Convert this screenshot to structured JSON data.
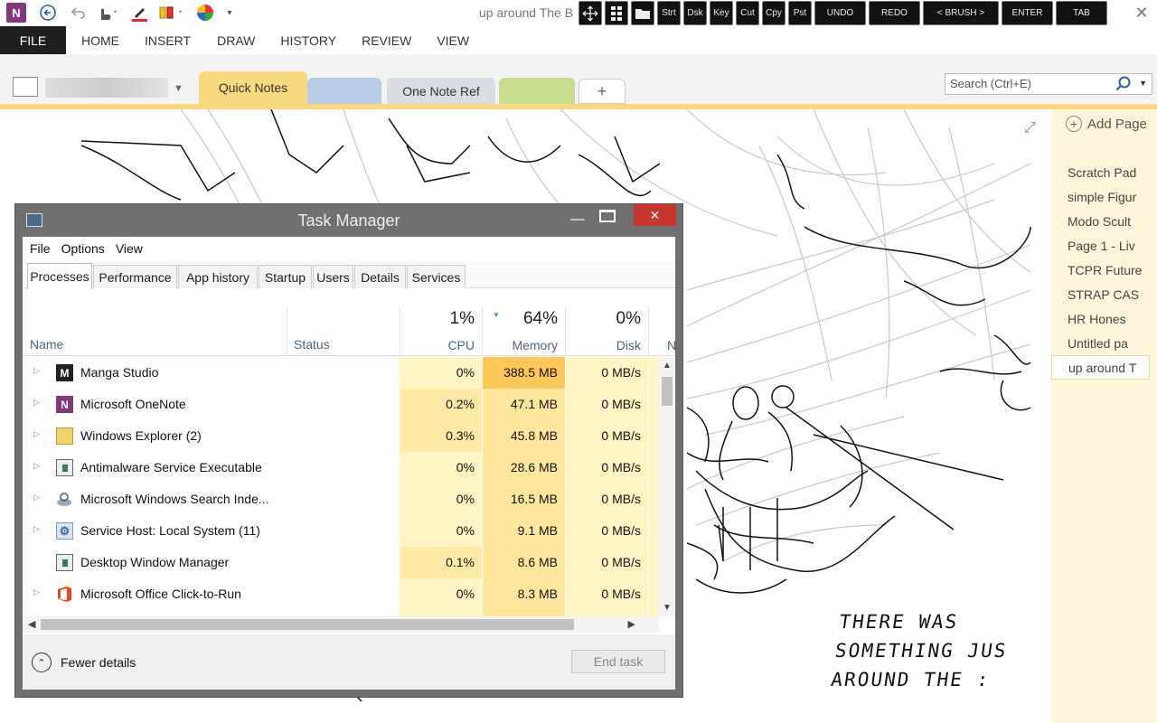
{
  "onenote": {
    "doc_title": "up around The B",
    "quick_access": [
      "onenote-logo",
      "back-icon",
      "undo-icon",
      "touch-mode-icon",
      "pen-icon",
      "highlighter-icon",
      "color-wheel-icon",
      "customize-icon"
    ],
    "close_glyph": "✕",
    "overlay_toolbar": [
      "Strt",
      "Dsk",
      "Key",
      "Cut",
      "Cpy",
      "Pst",
      "UNDO",
      "REDO",
      "< BRUSH >",
      "ENTER",
      "TAB"
    ],
    "ribbon_tabs": {
      "file": "FILE",
      "tabs": [
        "HOME",
        "INSERT",
        "DRAW",
        "HISTORY",
        "REVIEW",
        "VIEW"
      ]
    },
    "sections": {
      "quick_notes": "Quick Notes",
      "ref": "One Note Ref",
      "add": "+"
    },
    "search": {
      "placeholder": "Search (Ctrl+E)"
    },
    "add_page": "Add Page",
    "pages": [
      "Scratch Pad",
      "simple Figur",
      "Modo Scult",
      "Page 1 - Liv",
      "TCPR Future",
      "STRAP CAS",
      "HR Hones",
      "Untitled pa",
      "up around T"
    ],
    "handwriting": [
      "THERE WAS",
      "SOMETHING JUS",
      "AROUND THE :"
    ]
  },
  "task_manager": {
    "title": "Task Manager",
    "menu": [
      "File",
      "Options",
      "View"
    ],
    "tabs": [
      "Processes",
      "Performance",
      "App history",
      "Startup",
      "Users",
      "Details",
      "Services"
    ],
    "columns": {
      "name": "Name",
      "status": "Status",
      "cpu": {
        "pct": "1%",
        "label": "CPU"
      },
      "memory": {
        "pct": "64%",
        "label": "Memory"
      },
      "disk": {
        "pct": "0%",
        "label": "Disk"
      },
      "net": "N"
    },
    "rows": [
      {
        "name": "Manga Studio",
        "cpu": "0%",
        "memory": "388.5 MB",
        "disk": "0 MB/s",
        "expand": true
      },
      {
        "name": "Microsoft OneNote",
        "cpu": "0.2%",
        "memory": "47.1 MB",
        "disk": "0 MB/s",
        "expand": true
      },
      {
        "name": "Windows Explorer (2)",
        "cpu": "0.3%",
        "memory": "45.8 MB",
        "disk": "0 MB/s",
        "expand": true
      },
      {
        "name": "Antimalware Service Executable",
        "cpu": "0%",
        "memory": "28.6 MB",
        "disk": "0 MB/s",
        "expand": true
      },
      {
        "name": "Microsoft Windows Search Inde...",
        "cpu": "0%",
        "memory": "16.5 MB",
        "disk": "0 MB/s",
        "expand": true
      },
      {
        "name": "Service Host: Local System (11)",
        "cpu": "0%",
        "memory": "9.1 MB",
        "disk": "0 MB/s",
        "expand": true
      },
      {
        "name": "Desktop Window Manager",
        "cpu": "0.1%",
        "memory": "8.6 MB",
        "disk": "0 MB/s",
        "expand": false
      },
      {
        "name": "Microsoft Office Click-to-Run",
        "cpu": "0%",
        "memory": "8.3 MB",
        "disk": "0 MB/s",
        "expand": true
      }
    ],
    "fewer_details": "Fewer details",
    "end_task": "End task"
  }
}
